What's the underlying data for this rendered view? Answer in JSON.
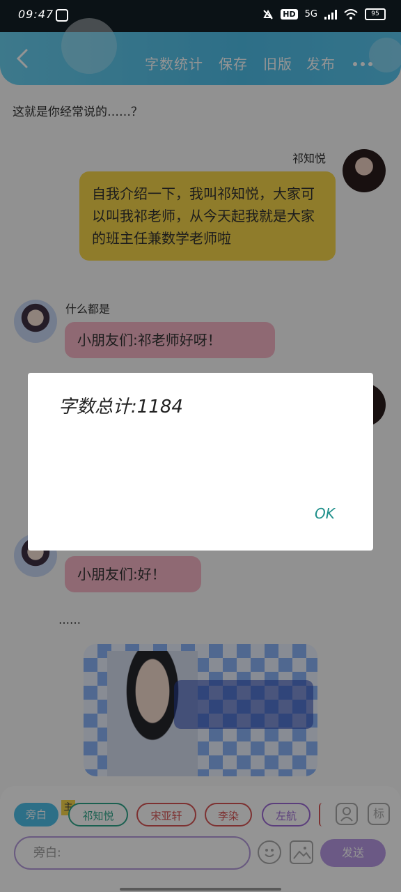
{
  "status_bar": {
    "time": "09:47",
    "hd": "HD",
    "network": "5G",
    "battery": "95"
  },
  "nav": {
    "word_count": "字数统计",
    "save": "保存",
    "old_version": "旧版",
    "publish": "发布"
  },
  "chat": {
    "narration": "这就是你经常说的……？",
    "msg1": {
      "name": "祁知悦",
      "text": "自我介绍一下，我叫祁知悦，大家可以叫我祁老师，从今天起我就是大家的班主任兼数学老师啦"
    },
    "msg2": {
      "name": "什么都是",
      "text": "小朋友们:祁老师好呀！"
    },
    "msg3": {
      "text": "小朋友们:好！"
    },
    "ellipsis": "……"
  },
  "bottom": {
    "chips": [
      "旁白",
      "祁知悦",
      "宋亚轩",
      "李染",
      "左航"
    ],
    "main_tag": "主",
    "tag_icon_label": "标",
    "input_placeholder": "旁白:",
    "send": "发送"
  },
  "dialog": {
    "message": "字数总计:1184",
    "ok": "OK"
  },
  "colors": {
    "accent": "#4fbfe9",
    "yellow": "#f7d64a",
    "pink": "#f6b6c6",
    "send": "#b89ae6"
  }
}
